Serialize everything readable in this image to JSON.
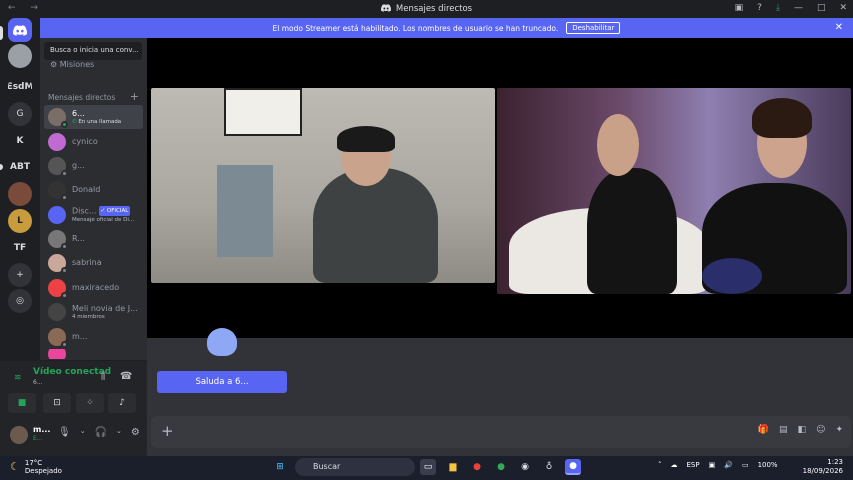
{
  "titlebar": {
    "title": "Mensajes directos",
    "nav": "← →"
  },
  "banner": {
    "text": "El modo Streamer está habilitado. Los nombres de usuario se han truncado.",
    "button": "Deshabilitar"
  },
  "servers": [
    {
      "label": "ESDM",
      "text": "EsdM"
    },
    {
      "label": "G",
      "text": "G"
    },
    {
      "label": "K",
      "text": "K"
    },
    {
      "label": "ABT",
      "text": "ABT"
    },
    {
      "label": "TF",
      "text": "TF"
    }
  ],
  "dms": {
    "search_placeholder": "Busca o inicia una conv...",
    "missions": "Misiones",
    "header": "Mensajes directos",
    "items": [
      {
        "name": "6...",
        "sub": "En una llamada",
        "color": "#7a6e66"
      },
      {
        "name": "cynico",
        "sub": "",
        "color": "#c06bd1"
      },
      {
        "name": "g...",
        "sub": "",
        "color": "#555"
      },
      {
        "name": "Donald",
        "sub": "",
        "color": "#333"
      },
      {
        "name": "Disc...",
        "sub": "Mensaje oficial de Di...",
        "badge": "✓ OFICIAL",
        "color": "#5865f2"
      },
      {
        "name": "R...",
        "sub": "",
        "color": "#777"
      },
      {
        "name": "sabrina",
        "sub": "",
        "color": "#c9a89a"
      },
      {
        "name": "maxiracedo",
        "sub": "",
        "color": "#ed4245"
      },
      {
        "name": "Meli novia de J...",
        "sub": "4 miembros",
        "color": "#444"
      },
      {
        "name": "m...",
        "sub": "",
        "color": "#8a6a55"
      }
    ]
  },
  "voice": {
    "status": "Vídeo conectad",
    "sub": "6..."
  },
  "user": {
    "name": "m...",
    "status": "E..."
  },
  "main": {
    "say_hi": "Saluda a 6..."
  },
  "taskbar": {
    "temp": "17°C",
    "weather": "Despejado",
    "search": "Buscar",
    "lang": "ESP",
    "battery": "100%",
    "time": "1:23",
    "date": "18/09/2026"
  }
}
